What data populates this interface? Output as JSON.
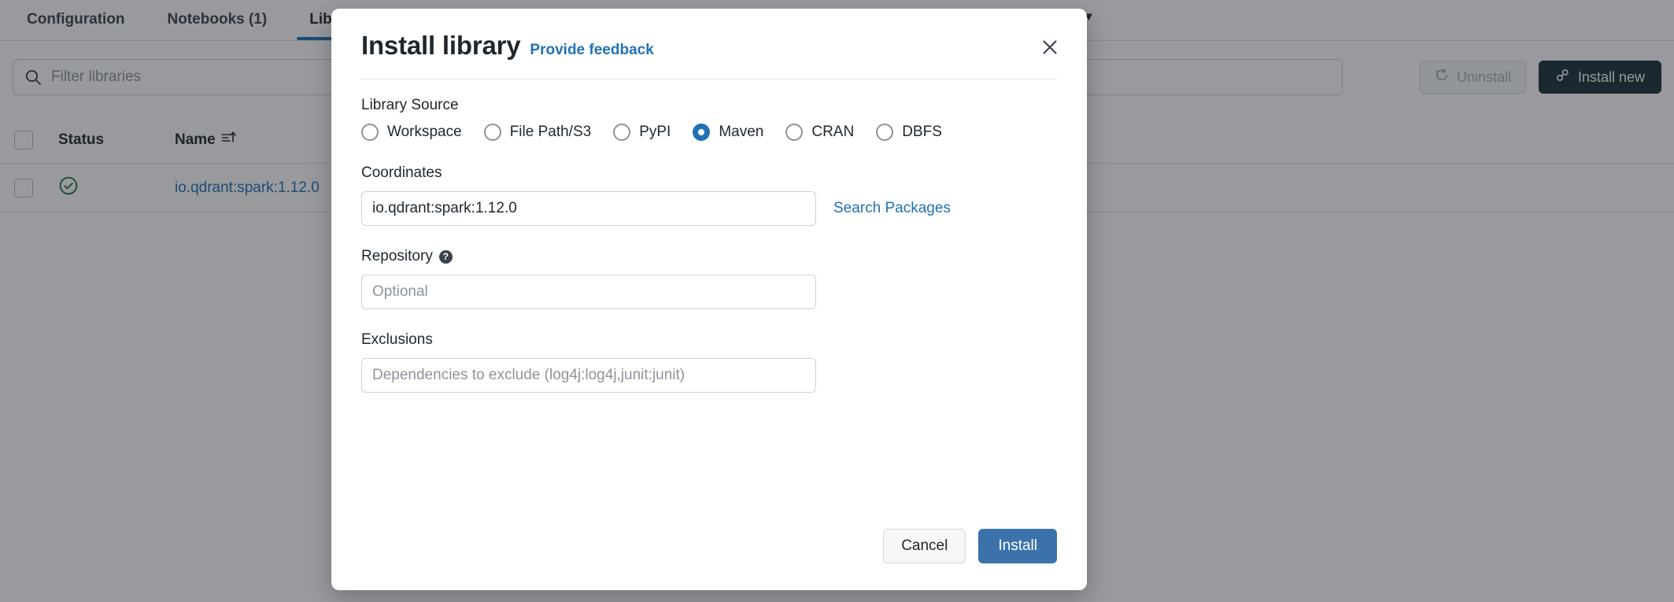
{
  "background": {
    "tabs": [
      {
        "label": "Configuration",
        "active": false
      },
      {
        "label": "Notebooks (1)",
        "active": false
      },
      {
        "label": "Libraries",
        "active": true
      }
    ],
    "tab_overflow_icon": "chevron-down-icon",
    "toolbar": {
      "filter_placeholder": "Filter libraries",
      "search_icon": "search-icon",
      "uninstall_label": "Uninstall",
      "uninstall_icon": "uninstall-icon",
      "install_new_label": "Install new",
      "install_new_icon": "link-chain-icon"
    },
    "table": {
      "columns": [
        "Status",
        "Name"
      ],
      "sort_icon": "sort-ascending-icon",
      "rows": [
        {
          "status_icon": "check-circle-icon",
          "status_color": "#1f6b44",
          "name": "io.qdrant:spark:1.12.0"
        }
      ]
    }
  },
  "modal": {
    "title": "Install library",
    "feedback_link": "Provide feedback",
    "close_icon": "close-icon",
    "library_source": {
      "label": "Library Source",
      "options": [
        {
          "label": "Workspace",
          "checked": false
        },
        {
          "label": "File Path/S3",
          "checked": false
        },
        {
          "label": "PyPI",
          "checked": false
        },
        {
          "label": "Maven",
          "checked": true
        },
        {
          "label": "CRAN",
          "checked": false
        },
        {
          "label": "DBFS",
          "checked": false
        }
      ],
      "selected": "Maven"
    },
    "coordinates": {
      "label": "Coordinates",
      "value": "io.qdrant:spark:1.12.0",
      "placeholder": "",
      "search_link": "Search Packages"
    },
    "repository": {
      "label": "Repository",
      "help_icon": "help-circle-icon",
      "value": "",
      "placeholder": "Optional"
    },
    "exclusions": {
      "label": "Exclusions",
      "value": "",
      "placeholder": "Dependencies to exclude (log4j:log4j,junit:junit)"
    },
    "footer": {
      "cancel_label": "Cancel",
      "install_label": "Install"
    }
  },
  "colors": {
    "accent_blue": "#2272b4",
    "primary_button": "#3b72ab",
    "dark_button": "#1b3139",
    "success_green": "#1f6b44"
  }
}
